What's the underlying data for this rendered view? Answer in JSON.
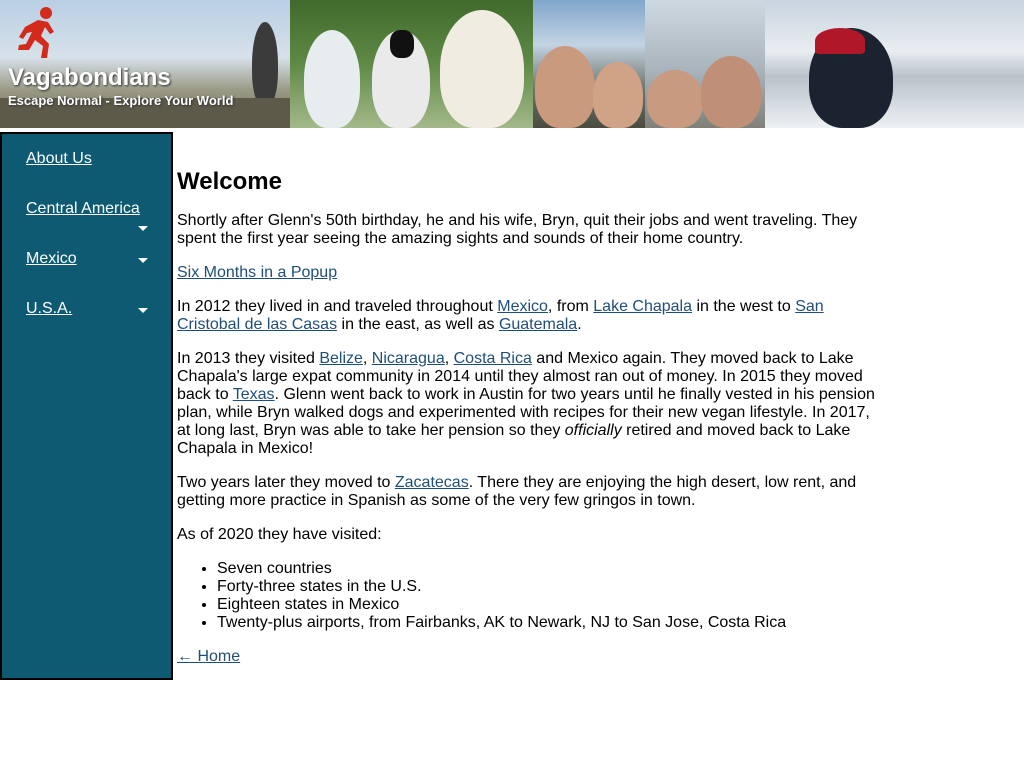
{
  "site": {
    "title": "Vagabondians",
    "tagline": "Escape Normal - Explore Your World"
  },
  "sidebar": {
    "items": [
      {
        "label": "About Us",
        "has_submenu": false
      },
      {
        "label": "Central America",
        "has_submenu": true
      },
      {
        "label": "Mexico",
        "has_submenu": true
      },
      {
        "label": "U.S.A.",
        "has_submenu": true
      }
    ]
  },
  "main": {
    "heading": "Welcome",
    "p1": "Shortly after Glenn's 50th birthday, he and his wife, Bryn, quit their jobs and went traveling. They spent the first year seeing the amazing sights and sounds of their home country.",
    "link_popup": "Six Months in a Popup",
    "p3": {
      "t1": "In 2012 they lived in and traveled throughout ",
      "mexico": "Mexico",
      "t2": ", from ",
      "lake_chapala": "Lake Chapala",
      "t3": " in the west to ",
      "san_cristobal": "San Cristobal de las Casas",
      "t4": " in the east, as well as ",
      "guatemala": "Guatemala",
      "t5": "."
    },
    "p4": {
      "t1": "In 2013 they visited ",
      "belize": "Belize",
      "t2": ", ",
      "nicaragua": "Nicaragua",
      "t3": ", ",
      "costa_rica": "Costa Rica",
      "t4": " and Mexico again. They moved back to Lake Chapala's large expat community in 2014 until they almost ran out of money. In 2015 they moved back to ",
      "texas": "Texas",
      "t5": ". Glenn went back to work in Austin for two years until he finally vested in his pension plan, while Bryn walked dogs and experimented with recipes for their new vegan lifestyle. In 2017, at long last, Bryn was able to take her pension so they ",
      "officially": "officially",
      "t6": " retired and moved back to Lake Chapala in Mexico!"
    },
    "p5": {
      "t1": "Two years later they moved to ",
      "zacatecas": "Zacatecas",
      "t2": ". There they are enjoying the high desert, low rent, and getting more practice in Spanish as some of the very few gringos in town."
    },
    "p6": "As of 2020 they have visited:",
    "visited_list": [
      "Seven countries",
      "Forty-three states in the U.S.",
      "Eighteen states in Mexico",
      "Twenty-plus airports, from Fairbanks, AK to Newark, NJ to San Jose, Costa Rica"
    ],
    "home_link": "← Home"
  },
  "colors": {
    "sidebar_bg": "#0e5a73",
    "link": "#1f4e79",
    "runner_icon": "#d42a1c"
  }
}
